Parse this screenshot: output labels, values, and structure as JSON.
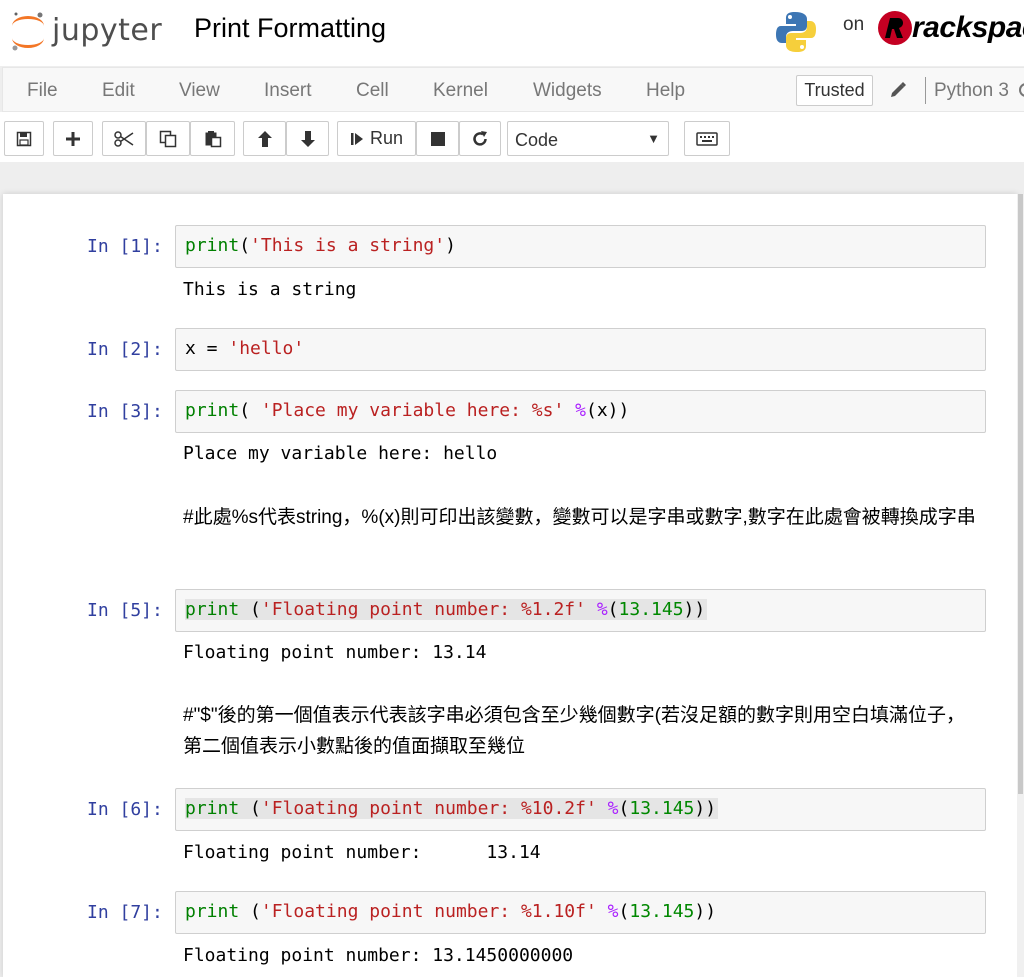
{
  "header": {
    "logo_text": "jupyter",
    "notebook_title": "Print Formatting",
    "on_text": "on",
    "host_logo_text": "rackspace"
  },
  "menubar": {
    "items": [
      "File",
      "Edit",
      "View",
      "Insert",
      "Cell",
      "Kernel",
      "Widgets",
      "Help"
    ],
    "trusted_label": "Trusted",
    "kernel_name": "Python 3"
  },
  "toolbar": {
    "run_label": "Run",
    "cell_type": "Code",
    "icons": [
      "save-icon",
      "plus-icon",
      "cut-icon",
      "copy-icon",
      "paste-icon",
      "arrow-up-icon",
      "arrow-down-icon",
      "run-icon",
      "stop-icon",
      "restart-icon",
      "keyboard-icon"
    ]
  },
  "cells": [
    {
      "prompt": "In [1]:",
      "code": [
        [
          "k",
          "print"
        ],
        [
          "p",
          "("
        ],
        [
          "s",
          "'This is a string'"
        ],
        [
          "p",
          ")"
        ]
      ],
      "output": "This is a string"
    },
    {
      "prompt": "In [2]:",
      "code": [
        [
          "p",
          "x = "
        ],
        [
          "s",
          "'hello'"
        ]
      ],
      "output": ""
    },
    {
      "prompt": "In [3]:",
      "code": [
        [
          "k",
          "print"
        ],
        [
          "p",
          "( "
        ],
        [
          "s",
          "'Place my variable here: %s'"
        ],
        [
          "p",
          " "
        ],
        [
          "o",
          "%"
        ],
        [
          "p",
          "(x))"
        ]
      ],
      "output": "Place my variable here: hello",
      "markdown": "#此處%s代表string，%(x)則可印出該變數，變數可以是字串或數字,數字在此處會被轉換成字串"
    },
    {
      "prompt": "In [5]:",
      "code": [
        [
          "k",
          "print"
        ],
        [
          "p",
          " ("
        ],
        [
          "s",
          "'Floating point number: %1.2f'"
        ],
        [
          "p",
          " "
        ],
        [
          "o",
          "%"
        ],
        [
          "p",
          "("
        ],
        [
          "n",
          "13.145"
        ],
        [
          "p",
          "))"
        ]
      ],
      "output": "Floating point number: 13.14",
      "markdown": "#\"$\"後的第一個值表示代表該字串必須包含至少幾個數字(若沒足額的數字則用空白填滿位子，第二個值表示小數點後的值面擷取至幾位"
    },
    {
      "prompt": "In [6]:",
      "code": [
        [
          "k",
          "print"
        ],
        [
          "p",
          " ("
        ],
        [
          "s",
          "'Floating point number: %10.2f'"
        ],
        [
          "p",
          " "
        ],
        [
          "o",
          "%"
        ],
        [
          "p",
          "("
        ],
        [
          "n",
          "13.145"
        ],
        [
          "p",
          "))"
        ]
      ],
      "output": "Floating point number:      13.14"
    },
    {
      "prompt": "In [7]:",
      "code": [
        [
          "k",
          "print"
        ],
        [
          "p",
          " ("
        ],
        [
          "s",
          "'Floating point number: %1.10f'"
        ],
        [
          "p",
          " "
        ],
        [
          "o",
          "%"
        ],
        [
          "p",
          "("
        ],
        [
          "n",
          "13.145"
        ],
        [
          "p",
          "))"
        ]
      ],
      "output": "Floating point number: 13.1450000000"
    }
  ]
}
